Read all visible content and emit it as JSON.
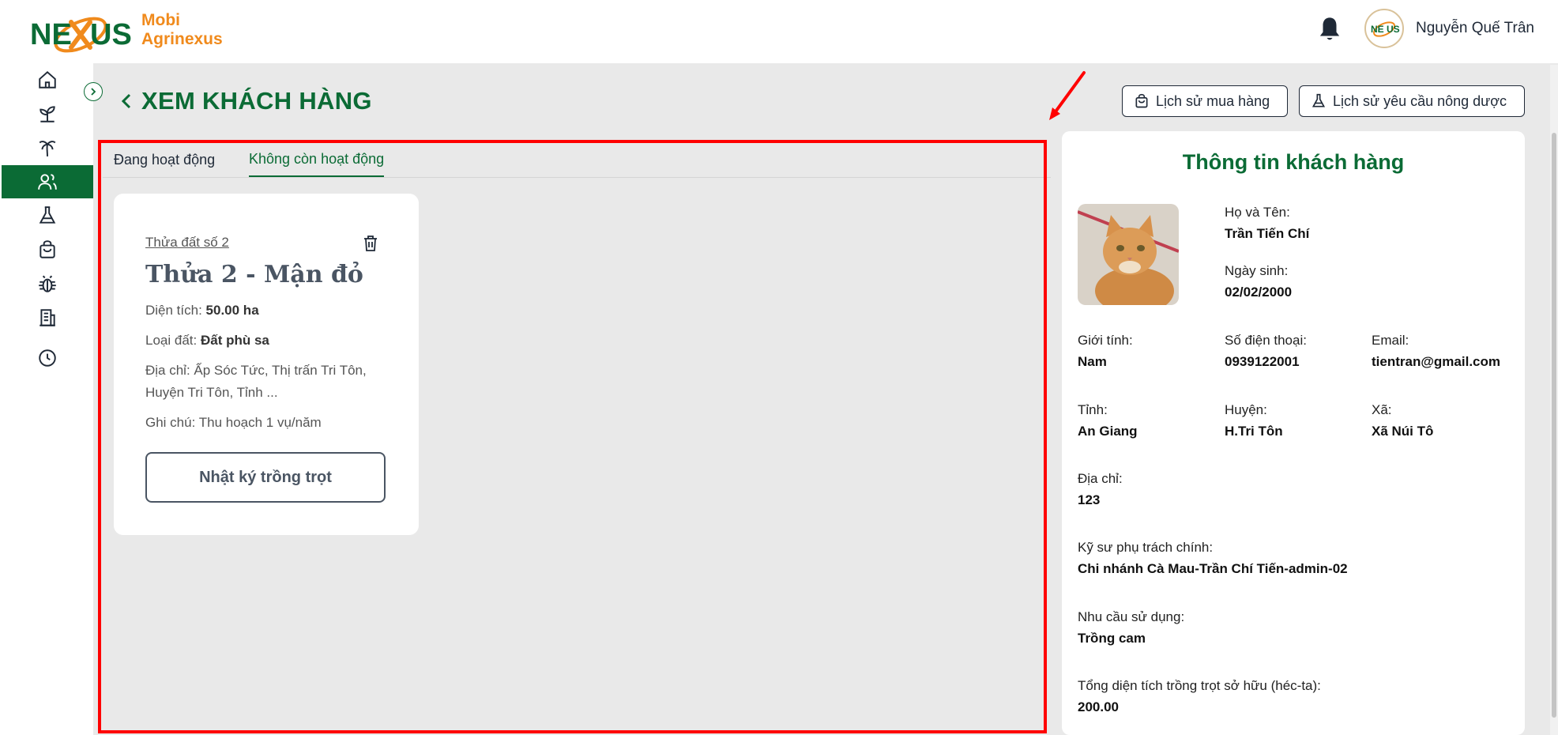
{
  "app": {
    "brand_line1": "Mobi",
    "brand_line2": "Agrinexus",
    "user_name": "Nguyễn Quế Trân",
    "accent_color": "#0b6b35",
    "brand_color": "#f08a1c"
  },
  "sidebar": {
    "items": [
      {
        "icon": "home-icon"
      },
      {
        "icon": "plant-icon"
      },
      {
        "icon": "palm-tree-icon"
      },
      {
        "icon": "users-icon",
        "active": true
      },
      {
        "icon": "flask-icon"
      },
      {
        "icon": "shopping-bag-icon"
      },
      {
        "icon": "bug-icon"
      },
      {
        "icon": "building-icon"
      },
      {
        "icon": "history-icon"
      }
    ]
  },
  "header": {
    "title": "XEM KHÁCH HÀNG",
    "purchase_history_label": "Lịch sử mua hàng",
    "request_history_label": "Lịch sử yêu cầu nông dược"
  },
  "tabs": [
    {
      "label": "Đang hoạt động",
      "active": false
    },
    {
      "label": "Không còn hoạt động",
      "active": true
    }
  ],
  "plots": [
    {
      "link": "Thửa đất số 2",
      "name": "Thửa 2 - Mận đỏ",
      "area_label": "Diện tích:",
      "area_value": "50.00 ha",
      "soil_label": "Loại đất:",
      "soil_value": "Đất phù sa",
      "address": "Địa chỉ: Ấp Sóc Tức, Thị trấn Tri Tôn, Huyện Tri Tôn, Tỉnh ...",
      "note": "Ghi chú: Thu hoạch 1 vụ/năm",
      "diary_button": "Nhật ký trồng trọt"
    }
  ],
  "customer": {
    "panel_title": "Thông tin khách hàng",
    "name_label": "Họ và Tên:",
    "name": "Trần Tiến Chí",
    "dob_label": "Ngày sinh:",
    "dob": "02/02/2000",
    "gender_label": "Giới tính:",
    "gender": "Nam",
    "phone_label": "Số điện thoại:",
    "phone": "0939122001",
    "email_label": "Email:",
    "email": "tientran@gmail.com",
    "province_label": "Tỉnh:",
    "province": "An Giang",
    "district_label": "Huyện:",
    "district": "H.Tri Tôn",
    "ward_label": "Xã:",
    "ward": "Xã Núi Tô",
    "address_label": "Địa chỉ:",
    "address": "123",
    "engineer_label": "Kỹ sư phụ trách chính:",
    "engineer": "Chi nhánh Cà Mau-Trần Chí Tiến-admin-02",
    "demand_label": "Nhu cầu sử dụng:",
    "demand": "Trồng cam",
    "total_area_label": "Tổng diện tích trồng trọt sở hữu (héc-ta):",
    "total_area": "200.00"
  }
}
